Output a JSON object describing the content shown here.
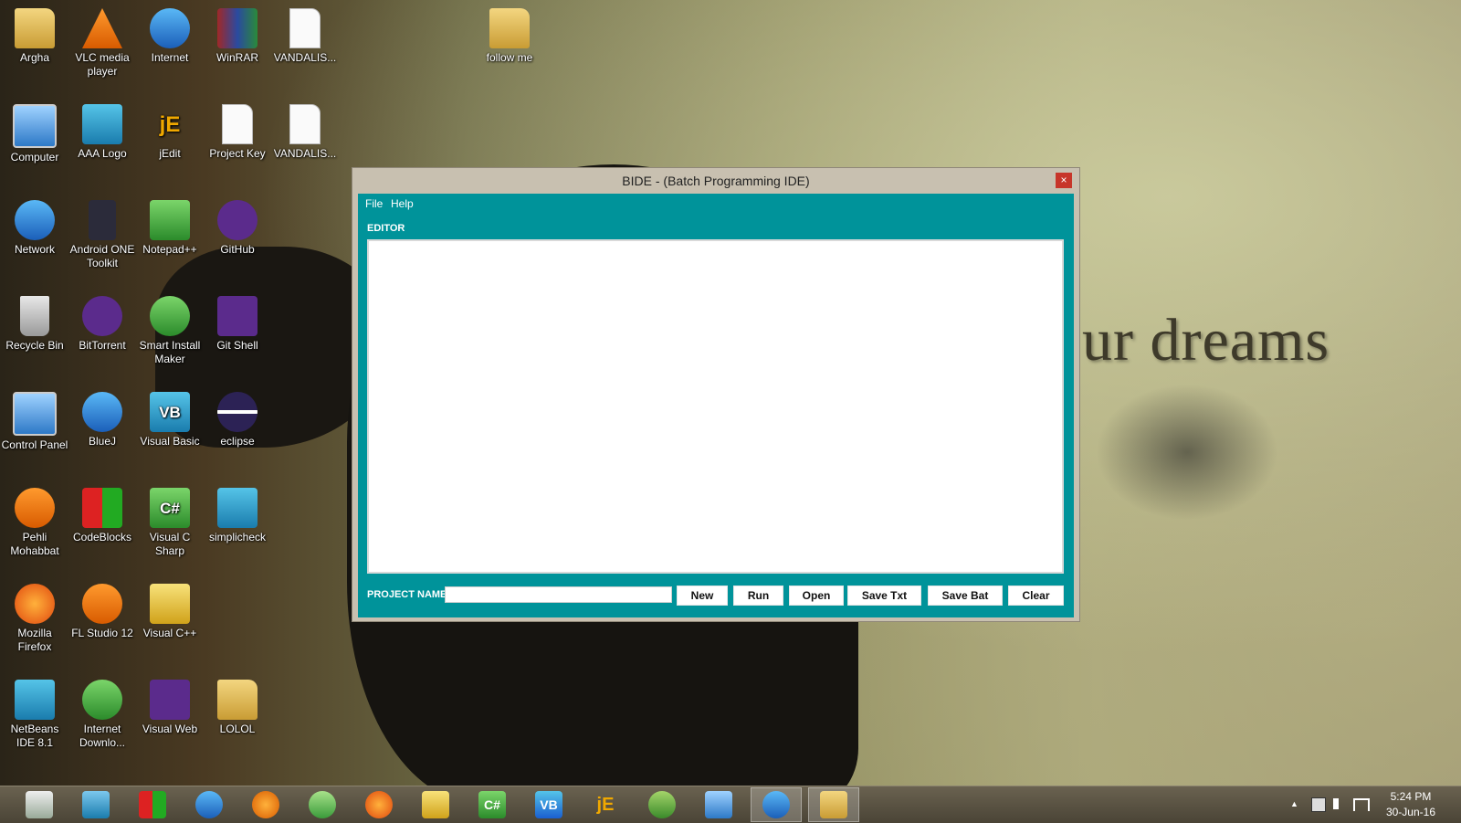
{
  "desktop": {
    "wallpaper_text": "ur dreams",
    "icons": [
      {
        "label": "Argha",
        "icon": "user-folder-icon"
      },
      {
        "label": "VLC media player",
        "icon": "vlc-icon"
      },
      {
        "label": "Internet",
        "icon": "internet-explorer-icon"
      },
      {
        "label": "WinRAR",
        "icon": "winrar-icon"
      },
      {
        "label": "VANDALIS...",
        "icon": "file-icon"
      },
      {
        "label": "follow me",
        "icon": "folder-icon"
      },
      {
        "label": "Computer",
        "icon": "computer-icon"
      },
      {
        "label": "AAA Logo",
        "icon": "aaa-logo-icon"
      },
      {
        "label": "jEdit",
        "icon": "jedit-icon"
      },
      {
        "label": "Project Key",
        "icon": "document-icon"
      },
      {
        "label": "VANDALIS...",
        "icon": "file-icon"
      },
      {
        "label": "Network",
        "icon": "network-icon"
      },
      {
        "label": "Android ONE Toolkit",
        "icon": "android-toolkit-icon"
      },
      {
        "label": "Notepad++",
        "icon": "notepadpp-icon"
      },
      {
        "label": "GitHub",
        "icon": "github-icon"
      },
      {
        "label": "Recycle Bin",
        "icon": "recycle-bin-icon"
      },
      {
        "label": "BitTorrent",
        "icon": "bittorrent-icon"
      },
      {
        "label": "Smart Install Maker",
        "icon": "installer-icon"
      },
      {
        "label": "Git Shell",
        "icon": "terminal-icon"
      },
      {
        "label": "Control Panel",
        "icon": "control-panel-icon"
      },
      {
        "label": "BlueJ",
        "icon": "bluej-icon"
      },
      {
        "label": "Visual Basic",
        "icon": "visual-basic-icon"
      },
      {
        "label": "eclipse",
        "icon": "eclipse-icon"
      },
      {
        "label": "Pehli Mohabbat",
        "icon": "fl-studio-icon"
      },
      {
        "label": "CodeBlocks",
        "icon": "codeblocks-icon"
      },
      {
        "label": "Visual C Sharp",
        "icon": "csharp-icon"
      },
      {
        "label": "simplicheck",
        "icon": "magnifier-icon"
      },
      {
        "label": "Mozilla Firefox",
        "icon": "firefox-icon"
      },
      {
        "label": "FL Studio 12",
        "icon": "fl-studio-icon"
      },
      {
        "label": "Visual C++",
        "icon": "cpp-icon"
      },
      {
        "label": "NetBeans IDE 8.1",
        "icon": "netbeans-icon"
      },
      {
        "label": "Internet Downlo...",
        "icon": "download-manager-icon"
      },
      {
        "label": "Visual Web",
        "icon": "visual-web-icon"
      },
      {
        "label": "LOLOL",
        "icon": "folder-icon"
      }
    ]
  },
  "window": {
    "title": "BIDE - (Batch Programming IDE)",
    "close_glyph": "×",
    "menu": {
      "file": "File",
      "help": "Help"
    },
    "editor_label": "EDITOR",
    "editor_value": "",
    "project_label": "PROJECT NAME",
    "project_value": "",
    "buttons": {
      "new": "New",
      "run": "Run",
      "open": "Open",
      "save_txt": "Save Txt",
      "save_bat": "Save Bat",
      "clear": "Clear"
    },
    "colors": {
      "client": "#00939a",
      "titlebar": "#c8c0b0",
      "close": "#c7352a"
    }
  },
  "taskbar": {
    "apps": [
      "task-manager-icon",
      "netbeans-icon",
      "codeblocks-icon",
      "bluej-icon",
      "fl-studio-icon",
      "installer-icon",
      "firefox-icon",
      "cpp-icon",
      "csharp-icon",
      "visual-basic-icon",
      "jedit-icon",
      "android-studio-icon",
      "file-explorer-icon",
      "internet-explorer-icon",
      "folder-icon"
    ],
    "labels": {
      "vb": "VB",
      "cs": "C#",
      "je": "jE"
    },
    "tray_up": "▲",
    "time": "5:24 PM",
    "date": "30-Jun-16"
  }
}
